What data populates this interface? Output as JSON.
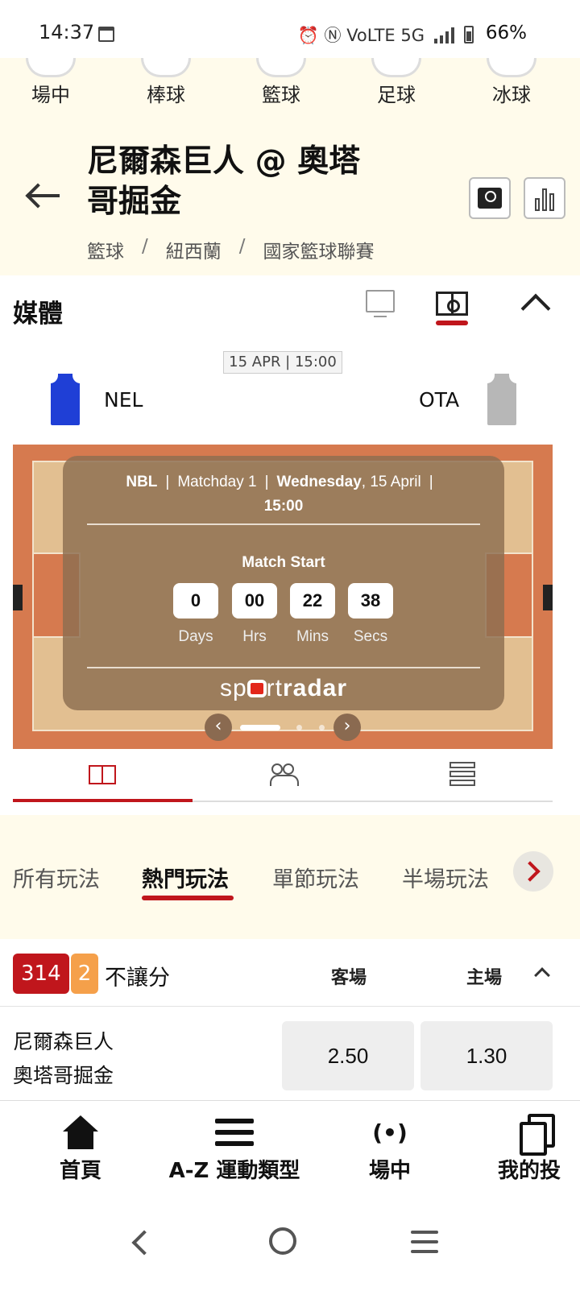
{
  "status_bar": {
    "time": "14:37",
    "indicators": "⏰ Ⓝ VoLTE 5G",
    "battery": "66%"
  },
  "sports_nav": [
    "場中",
    "棒球",
    "籃球",
    "足球",
    "冰球"
  ],
  "match": {
    "title": "尼爾森巨人 @ 奧塔哥掘金",
    "breadcrumb": [
      "籃球",
      "紐西蘭",
      "國家籃球聯賽"
    ]
  },
  "media": {
    "title": "媒體",
    "date_badge": "15 APR | 15:00",
    "home_code": "NEL",
    "away_code": "OTA",
    "home_jersey_color": "#1f3fd6",
    "away_jersey_color": "#b7b7b7"
  },
  "scoreboard": {
    "league": "NBL",
    "matchday": "Matchday 1",
    "weekday": "Wednesday",
    "date": ", 15 April",
    "time": "15:00",
    "start_label": "Match Start",
    "countdown": [
      {
        "value": "0",
        "label": "Days"
      },
      {
        "value": "00",
        "label": "Hrs"
      },
      {
        "value": "22",
        "label": "Mins"
      },
      {
        "value": "38",
        "label": "Secs"
      }
    ],
    "brand_prefix": "sp",
    "brand_mid": "rt",
    "brand_suffix": "radar"
  },
  "bet_tabs": {
    "items": [
      "所有玩法",
      "熱門玩法",
      "單節玩法",
      "半場玩法"
    ],
    "active": "熱門玩法"
  },
  "market": {
    "count": "314",
    "live_count": "2",
    "title": "不讓分",
    "col_away": "客場",
    "col_home": "主場",
    "team1": "尼爾森巨人",
    "team2": "奧塔哥掘金",
    "odds_away": "2.50",
    "odds_home": "1.30"
  },
  "bottom_nav": {
    "home": "首頁",
    "az": "A-Z 運動類型",
    "live": "場中",
    "bets": "我的投"
  },
  "colors": {
    "accent": "#c0161c",
    "cream": "#fffbeb",
    "live_badge": "#f5a04a"
  }
}
